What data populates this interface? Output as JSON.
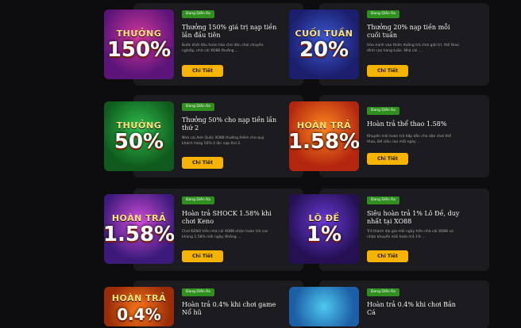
{
  "promotions": [
    {
      "badge": "Đang Diễn Ra",
      "title": "Thưởng 150% giá trị nạp tiền lần đầu tiên",
      "desc": "Bước khởi đầu hoàn hảo cho dân chơi chuyên nghiệp, nhà cái XO88 thưởng ...",
      "button": "Chi Tiết",
      "art_top": "THƯỞNG",
      "art_main": "150%"
    },
    {
      "badge": "Đang Diễn Ra",
      "title": "Thưởng 20% nạp tiền mỗi cuối tuần",
      "desc": "Hòa mình vào thiên đường trò chơi giải trí, thế thao đỉnh cao hàng tuần. Nhà cái ...",
      "button": "Chi Tiết",
      "art_top": "CUỐI TUẦN",
      "art_main": "20%"
    },
    {
      "badge": "Đang Diễn Ra",
      "title": "Thưởng 50% cho nạp tiền lần thứ 2",
      "desc": "Nhà cái Anh Quốc XO88 thưởng thêm cho quý khách hàng 50% ở lần nạp thứ 2.",
      "button": "Chi Tiết",
      "art_top": "THƯỞNG",
      "art_main": "50%"
    },
    {
      "badge": "Đang Diễn Ra",
      "title": "Hoàn trả thể thao 1.58%",
      "desc": "Khuyến mãi hoàn trả hấp dẫn cho dân chơi thể thao, Để siêu cao mỗi ngày ...",
      "button": "Chi Tiết",
      "art_top": "HOÀN TRẢ",
      "art_main": "1.58%"
    },
    {
      "badge": "Đang Diễn Ra",
      "title": "Hoàn trả SHOCK 1.58% khi chơi Keno",
      "desc": "Chơi KENO trên nhà cái XO88 nhận hoàn trả cực khủng 1.58% mỗi ngày. Không ...",
      "button": "Chi Tiết",
      "art_top": "HOÀN TRẢ",
      "art_main": "1.58%"
    },
    {
      "badge": "Đang Diễn Ra",
      "title": "Siêu hoàn trả 1% Lô Đề, duy nhất tại XO88",
      "desc": "Trở thành đại gia mỗi ngày trên nhà cái XO88 và nhận khuyến mãi hoàn trả 1% ...",
      "button": "Chi Tiết",
      "art_top": "LÔ ĐỀ",
      "art_main": "1%"
    },
    {
      "badge": "Đang Diễn Ra",
      "title": "Hoàn trả 0.4% khi chơi game Nổ hũ",
      "desc": "",
      "button": "",
      "art_top": "HOÀN TRẢ",
      "art_main": "0.4%"
    },
    {
      "badge": "Đang Diễn Ra",
      "title": "Hoàn trả 0.4% khi chơi Bắn Cá",
      "desc": "",
      "button": "",
      "art_top": "",
      "art_main": ""
    }
  ]
}
